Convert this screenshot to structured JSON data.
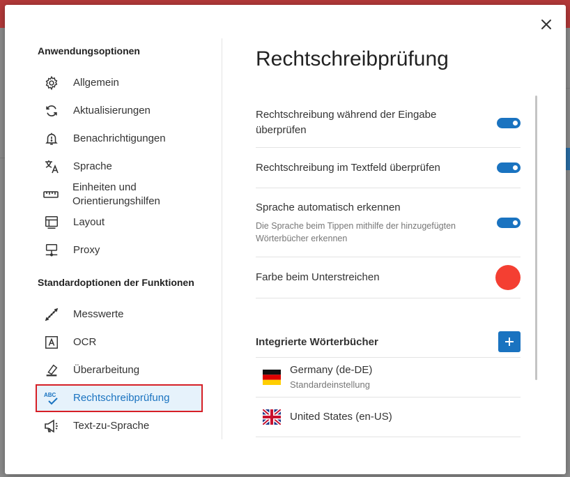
{
  "sidebar": {
    "section1_title": "Anwendungsoptionen",
    "items1": [
      {
        "label": "Allgemein",
        "icon": "gear-icon"
      },
      {
        "label": "Aktualisierungen",
        "icon": "refresh-icon"
      },
      {
        "label": "Benachrichtigungen",
        "icon": "bell-icon"
      },
      {
        "label": "Sprache",
        "icon": "translate-icon"
      },
      {
        "label": "Einheiten und Orientierungshilfen",
        "icon": "ruler-icon"
      },
      {
        "label": "Layout",
        "icon": "layout-icon"
      },
      {
        "label": "Proxy",
        "icon": "network-icon"
      }
    ],
    "section2_title": "Standardoptionen der Funktionen",
    "items2": [
      {
        "label": "Messwerte",
        "icon": "measure-icon"
      },
      {
        "label": "OCR",
        "icon": "ocr-icon"
      },
      {
        "label": "Überarbeitung",
        "icon": "eraser-icon"
      },
      {
        "label": "Rechtschreibprüfung",
        "icon": "spellcheck-icon",
        "active": true
      },
      {
        "label": "Text-zu-Sprache",
        "icon": "megaphone-icon"
      }
    ]
  },
  "main": {
    "title": "Rechtschreibprüfung",
    "settings": [
      {
        "label": "Rechtschreibung während der Eingabe überprüfen",
        "enabled": true
      },
      {
        "label": "Rechtschreibung im Textfeld überprüfen",
        "enabled": true
      },
      {
        "label": "Sprache automatisch erkennen",
        "sub": "Die Sprache beim Tippen mithilfe der hinzugefügten Wörterbücher erkennen",
        "enabled": true
      }
    ],
    "underline_color_label": "Farbe beim Unterstreichen",
    "underline_color": "#f43f32",
    "dictionaries_title": "Integrierte Wörterbücher",
    "dictionaries": [
      {
        "name": "Germany (de-DE)",
        "sub": "Standardeinstellung",
        "flag": "de-flag-icon"
      },
      {
        "name": "United States (en-US)",
        "sub": "",
        "flag": "us-flag-icon"
      }
    ]
  },
  "colors": {
    "accent": "#1a73c0",
    "highlight_border": "#d61f26",
    "active_bg": "#e6f2fb"
  }
}
